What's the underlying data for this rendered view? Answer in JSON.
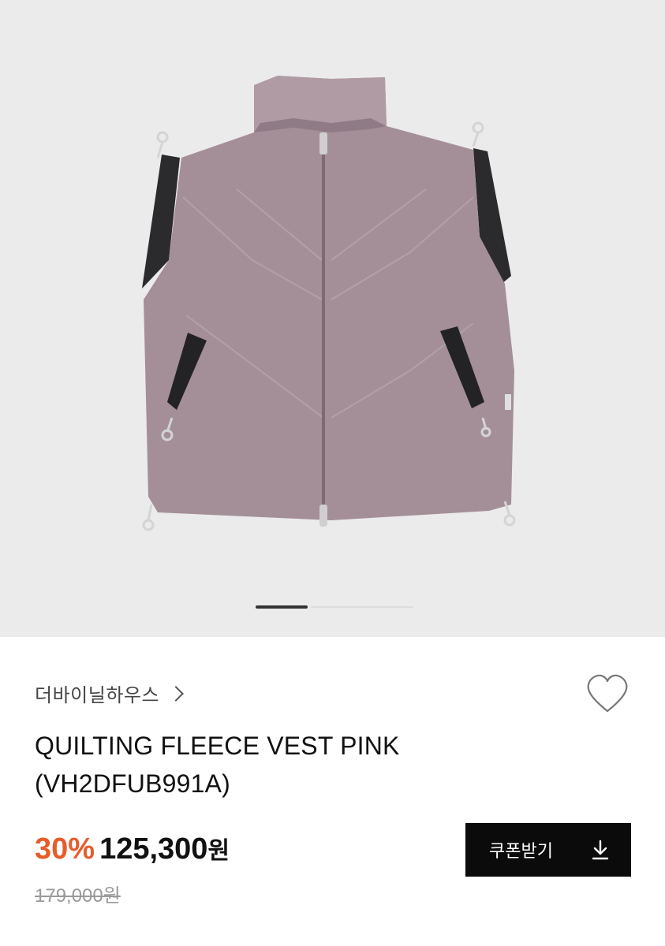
{
  "gallery": {
    "image_alt": "QUILTING FLEECE VEST PINK product photo",
    "slide_count": 3,
    "active_slide": 1
  },
  "product": {
    "brand": "더바이닐하우스",
    "title_line1": "QUILTING FLEECE VEST PINK",
    "title_line2": "(VH2DFUB991A)",
    "discount": "30%",
    "sale_price": "125,300",
    "currency": "원",
    "original_price": "179,000원"
  },
  "actions": {
    "coupon_label": "쿠폰받기"
  },
  "icons": {
    "brand_link": "chevron-right-icon",
    "wishlist": "heart-outline-icon",
    "coupon": "download-icon"
  },
  "colors": {
    "discount": "#e65c2a",
    "button_bg": "#0b0b0b",
    "hero_bg": "#ebebeb",
    "vest": "#a48f99",
    "trim": "#2b2b2d"
  }
}
